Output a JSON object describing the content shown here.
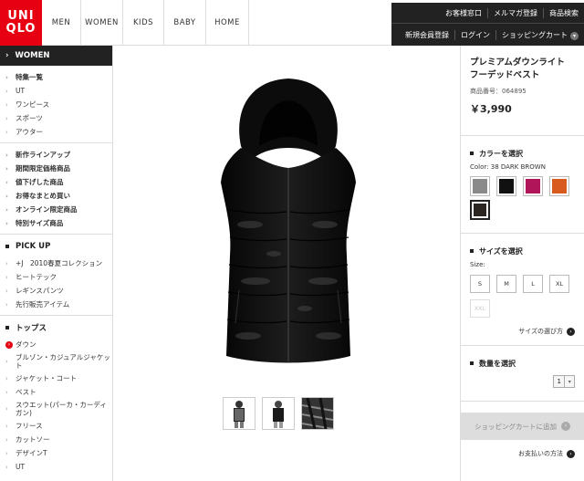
{
  "logo": {
    "line1": "UNI",
    "line2": "QLO"
  },
  "nav": [
    "MEN",
    "WOMEN",
    "KIDS",
    "BABY",
    "HOME"
  ],
  "util_top": [
    "お客様窓口",
    "メルマガ登録",
    "商品検索"
  ],
  "util_bottom": [
    "新規会員登録",
    "ログイン",
    "ショッピングカート"
  ],
  "sidebar": {
    "header": "WOMEN",
    "group1": [
      "特集一覧",
      "UT",
      "ワンピース",
      "スポーツ",
      "アウター"
    ],
    "group2": [
      "新作ラインアップ",
      "期間限定価格商品",
      "値下げした商品",
      "お得なまとめ買い",
      "オンライン限定商品",
      "特別サイズ商品"
    ],
    "pickup_title": "PICK UP",
    "pickup": [
      "+J　2010春夏コレクション",
      "ヒートテック",
      "レギンスパンツ",
      "先行販売アイテム"
    ],
    "tops_title": "トップス",
    "tops": [
      "ダウン",
      "ブルゾン・カジュアルジャケット",
      "ジャケット・コート",
      "ベスト",
      "スウエット(パーカ・カーディガン)",
      "フリース",
      "カットソー",
      "デザインT",
      "UT"
    ]
  },
  "product": {
    "name_line1": "プレミアムダウンライト",
    "name_line2": "フーデッドベスト",
    "code": "商品番号：064895",
    "price": "￥3,990"
  },
  "color": {
    "title": "カラーを選択",
    "label": "Color: 38 DARK BROWN",
    "swatches": [
      "#8a8a8a",
      "#111111",
      "#b0155a",
      "#d95a1e",
      "#2a2520"
    ]
  },
  "size": {
    "title": "サイズを選択",
    "label": "Size:",
    "options": [
      "S",
      "M",
      "L",
      "XL",
      "XXL"
    ],
    "guide": "サイズの選び方"
  },
  "quantity": {
    "title": "数量を選択",
    "value": "1"
  },
  "cart_button": "ショッピングカートに追加",
  "payment_link": "お支払いの方法"
}
